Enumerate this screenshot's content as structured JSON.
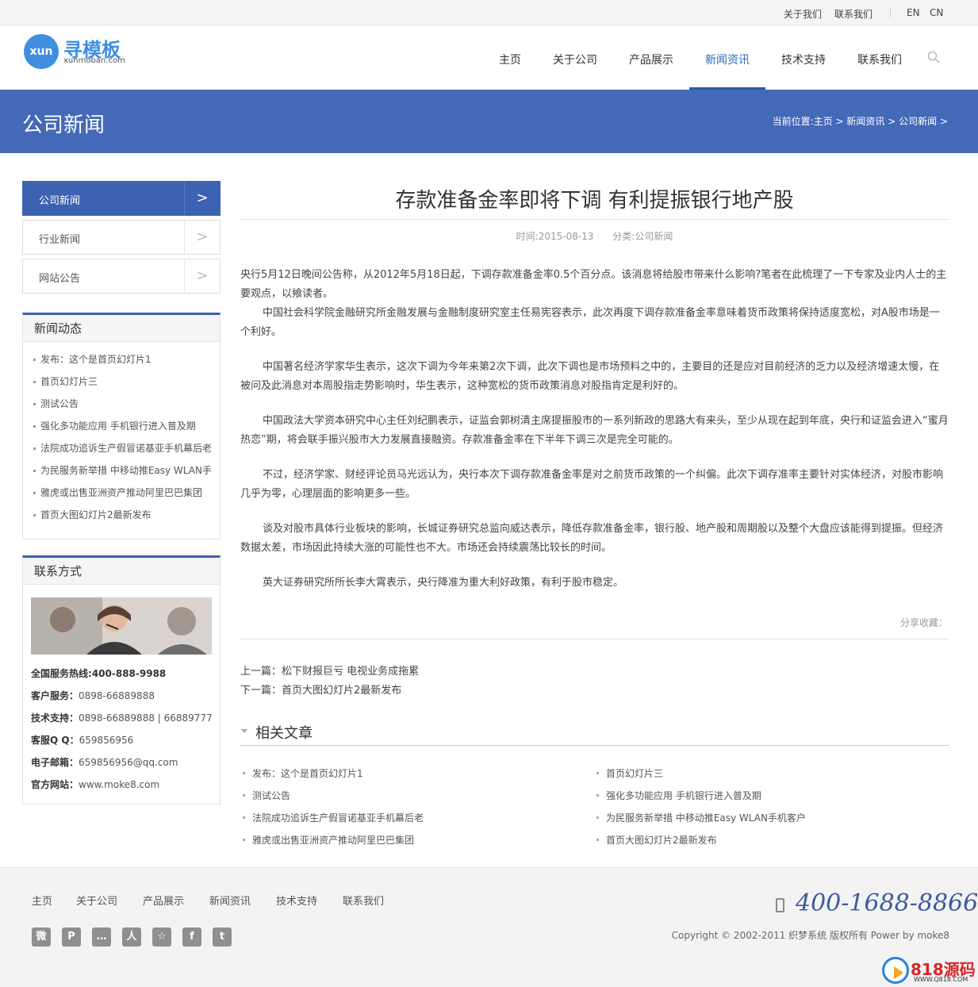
{
  "topbar": {
    "about": "关于我们",
    "contact": "联系我们",
    "en": "EN",
    "cn": "CN"
  },
  "logo": {
    "badge": "xun",
    "name": "寻模板",
    "domain": "xunmoban.com"
  },
  "nav": [
    "主页",
    "关于公司",
    "产品展示",
    "新闻资讯",
    "技术支持",
    "联系我们"
  ],
  "nav_active": "新闻资讯",
  "banner": {
    "title": "公司新闻",
    "breadcrumb_prefix": "当前位置:",
    "breadcrumb": [
      "主页",
      "新闻资讯",
      "公司新闻"
    ],
    "sep": ">"
  },
  "side_menu": [
    {
      "label": "公司新闻",
      "arrow": ">"
    },
    {
      "label": "行业新闻",
      "arrow": ">"
    },
    {
      "label": "网站公告",
      "arrow": ">"
    }
  ],
  "news_box": {
    "title": "新闻动态",
    "items": [
      "发布：这个是首页幻灯片1",
      "首页幻灯片三",
      "测试公告",
      "强化多功能应用 手机银行进入普及期",
      "法院成功追诉生产假冒诺基亚手机幕后老",
      "为民服务新举措 中移动推Easy WLAN手",
      "雅虎或出售亚洲资产推动阿里巴巴集团",
      "首页大图幻灯片2最新发布"
    ]
  },
  "contact_box": {
    "title": "联系方式",
    "hotline_label": "全国服务热线:",
    "hotline": "400-888-9988",
    "service_label": "客户服务：",
    "service": "0898-66889888",
    "tech_label": "技术支持：",
    "tech": "0898-66889888 | 66889777",
    "qq_label": "客服Q Q：",
    "qq": "659856956",
    "email_label": "电子邮箱：",
    "email": "659856956@qq.com",
    "site_label": "官方网站：",
    "site": "www.moke8.com"
  },
  "article": {
    "title": "存款准备金率即将下调 有利提振银行地产股",
    "time": "时间:2015-08-13",
    "category": "分类:公司新闻",
    "paragraphs": [
      "央行5月12日晚间公告称，从2012年5月18日起，下调存款准备金率0.5个百分点。该消息将给股市带来什么影响?笔者在此梳理了一下专家及业内人士的主要观点，以飨读者。",
      "中国社会科学院金融研究所金融发展与金融制度研究室主任易宪容表示，此次再度下调存款准备金率意味着货币政策将保持适度宽松，对A股市场是一个利好。",
      "中国著名经济学家华生表示，这次下调为今年来第2次下调，此次下调也是市场预料之中的，主要目的还是应对目前经济的乏力以及经济增速太慢，在被问及此消息对本周股指走势影响时，华生表示，这种宽松的货币政策消息对股指肯定是利好的。",
      "中国政法大学资本研究中心主任刘纪鹏表示，证监会郭树清主席提振股市的一系列新政的思路大有来头，至少从现在起到年底，央行和证监会进入“蜜月热恋”期，将会联手振兴股市大力发展直接融资。存款准备金率在下半年下调三次是完全可能的。",
      "不过，经济学家、财经评论员马光远认为，央行本次下调存款准备金率是对之前货币政策的一个纠偏。此次下调存准率主要针对实体经济，对股市影响几乎为零，心理层面的影响更多一些。",
      "谈及对股市具体行业板块的影响，长城证券研究总监向威达表示，降低存款准备金率，银行股、地产股和周期股以及整个大盘应该能得到提振。但经济数据太差，市场因此持续大涨的可能性也不大。市场还会持续震荡比较长的时间。",
      "英大证券研究所所长李大霄表示，央行降准为重大利好政策，有利于股市稳定。"
    ],
    "share_label": "分享收藏：",
    "prev": "上一篇：松下财报巨亏 电视业务成拖累",
    "next": "下一篇：首页大图幻灯片2最新发布"
  },
  "related": {
    "title": "相关文章",
    "items": [
      "发布：这个是首页幻灯片1",
      "首页幻灯片三",
      "测试公告",
      "强化多功能应用 手机银行进入普及期",
      "法院成功追诉生产假冒诺基亚手机幕后老",
      "为民服务新举措 中移动推Easy WLAN手机客户",
      "雅虎或出售亚洲资产推动阿里巴巴集团",
      "首页大图幻灯片2最新发布"
    ]
  },
  "footer": {
    "nav": [
      "主页",
      "关于公司",
      "产品展示",
      "新闻资讯",
      "技术支持",
      "联系我们"
    ],
    "social_icons": [
      "weibo-icon",
      "pinterest-icon",
      "chat-icon",
      "renren-icon",
      "star-icon",
      "facebook-icon",
      "twitter-icon"
    ],
    "social_glyphs": [
      "微",
      "P",
      "…",
      "人",
      "☆",
      "f",
      "t"
    ],
    "phone": "400-1688-8866",
    "copyright": "Copyright © 2002-2011 织梦系统 版权所有 Power by moke8"
  },
  "watermark": {
    "text": "818源码",
    "sub": "WWW.Q818.COM"
  },
  "colors": {
    "brand_blue": "#4469b8",
    "menu_active": "#3c62b1",
    "phone_blue": "#3d5b9d"
  }
}
